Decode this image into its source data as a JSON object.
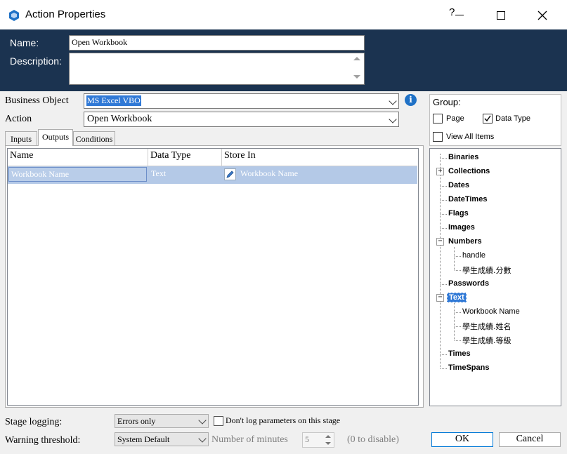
{
  "window": {
    "title": "Action Properties",
    "help": "?"
  },
  "header": {
    "name_label": "Name:",
    "name_value": "Open Workbook",
    "description_label": "Description:",
    "description_value": ""
  },
  "business_object": {
    "label": "Business Object",
    "value": "MS Excel VBO"
  },
  "action": {
    "label": "Action",
    "value": "Open Workbook"
  },
  "tabs": [
    {
      "label": "Inputs"
    },
    {
      "label": "Outputs",
      "selected": true
    },
    {
      "label": "Conditions"
    }
  ],
  "grid": {
    "columns": [
      "Name",
      "Data Type",
      "Store In"
    ],
    "rows": [
      {
        "name": "Workbook Name",
        "data_type": "Text",
        "store_in": "Workbook Name"
      }
    ]
  },
  "group": {
    "label": "Group:",
    "page": {
      "label": "Page",
      "checked": false
    },
    "data_type": {
      "label": "Data Type",
      "checked": true
    },
    "view_all": {
      "label": "View All Items",
      "checked": false
    }
  },
  "tree": {
    "binaries": "Binaries",
    "collections": "Collections",
    "dates": "Dates",
    "datetimes": "DateTimes",
    "flags": "Flags",
    "images": "Images",
    "numbers": "Numbers",
    "numbers_children": [
      "handle",
      "學生成績.分數"
    ],
    "passwords": "Passwords",
    "text": "Text",
    "text_children": [
      "Workbook Name",
      "學生成績.姓名",
      "學生成績.等級"
    ],
    "times": "Times",
    "timespans": "TimeSpans"
  },
  "bottom": {
    "stage_logging_label": "Stage logging:",
    "stage_logging_value": "Errors only",
    "dont_log_label": "Don't log parameters on this stage",
    "warning_label": "Warning threshold:",
    "warning_value": "System Default",
    "minutes_label": "Number of minutes",
    "minutes_value": "5",
    "disable_hint": "(0 to disable)",
    "ok_label": "OK",
    "cancel_label": "Cancel"
  }
}
